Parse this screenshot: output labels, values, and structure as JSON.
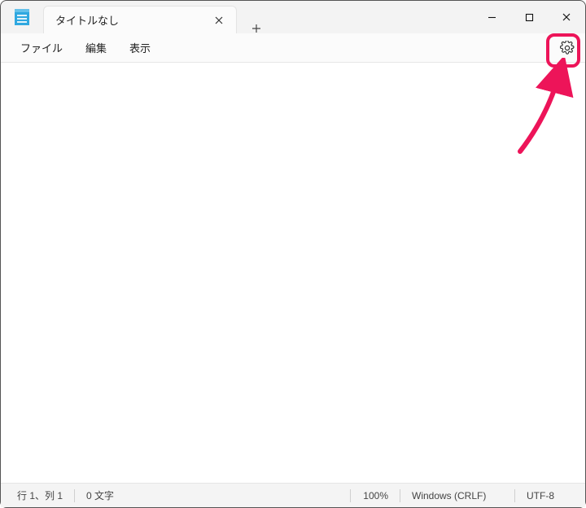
{
  "window": {
    "app_name": "Notepad"
  },
  "tabs": [
    {
      "title": "タイトルなし"
    }
  ],
  "menubar": {
    "file": "ファイル",
    "edit": "編集",
    "view": "表示"
  },
  "status": {
    "position": "行 1、列 1",
    "char_count": "0 文字",
    "zoom": "100%",
    "line_ending": "Windows (CRLF)",
    "encoding": "UTF-8"
  },
  "annotation": {
    "color": "#ed1459",
    "target": "settings-button"
  }
}
